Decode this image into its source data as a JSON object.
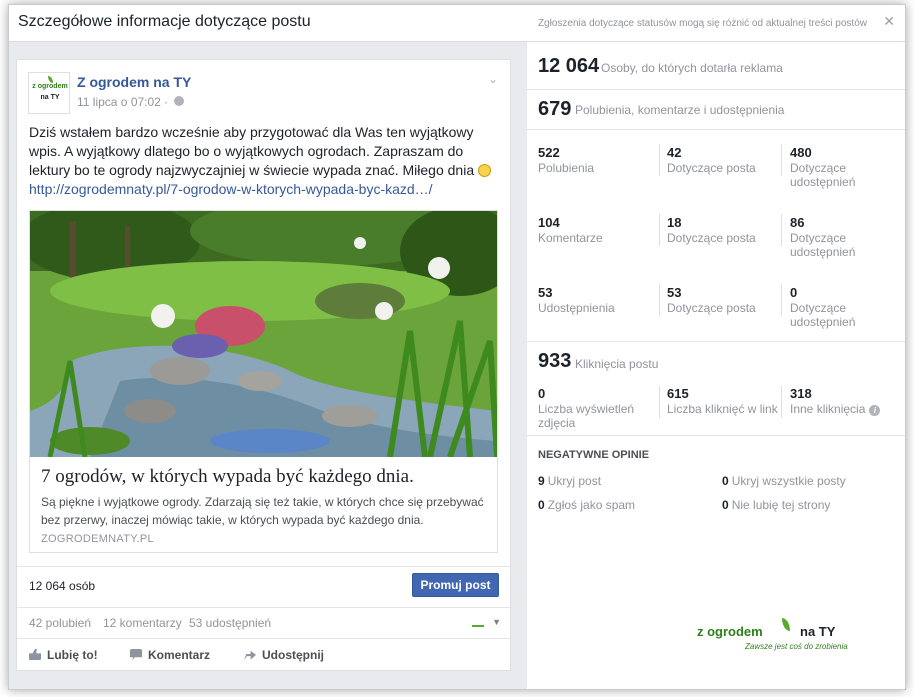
{
  "dialog": {
    "title": "Szczegółowe informacje dotyczące postu",
    "note": "Zgłoszenia dotyczące statusów mogą się różnić od aktualnej treści postów",
    "close_label": "✕"
  },
  "post": {
    "page_name": "Z ogrodem na TY",
    "logo_line1": "z ogrodem",
    "logo_line2": "na TY",
    "time": "11 lipca o 07:02 ·",
    "text": "Dziś wstałem bardzo wcześnie aby przygotować dla Was ten wyjątkowy wpis. A wyjątkowy dlatego bo o wyjątkowych ogrodach. Zapraszam do lektury bo te ogrody najzwyczajniej w świecie wypada znać. Miłego dnia",
    "link": "http://zogrodemnaty.pl/7-ogrodow-w-ktorych-wypada-byc-kazd…/",
    "attachment": {
      "title": "7 ogrodów, w których wypada być każdego dnia.",
      "description": "Są piękne i wyjątkowe ogrody. Zdarzają się też takie, w których chce się przebywać bez przerwy, inaczej mówiąc takie, w których wypada być każdego dnia.",
      "domain": "ZOGRODEMNATY.PL"
    },
    "reach": "12 064 osób",
    "promote_label": "Promuj post",
    "likes": "42 polubień",
    "comments": "12 komentarzy",
    "shares": "53 udostępnień",
    "actions": {
      "like": "Lubię to!",
      "comment": "Komentarz",
      "share": "Udostępnij"
    }
  },
  "stats": {
    "reach_num": "12 064",
    "reach_label": "Osoby, do których dotarła reklama",
    "engagement_num": "679",
    "engagement_label": "Polubienia, komentarze i udostępnienia",
    "rows": [
      [
        {
          "num": "522",
          "label": "Polubienia"
        },
        {
          "num": "42",
          "label": "Dotyczące posta"
        },
        {
          "num": "480",
          "label": "Dotyczące udostępnień"
        }
      ],
      [
        {
          "num": "104",
          "label": "Komentarze"
        },
        {
          "num": "18",
          "label": "Dotyczące posta"
        },
        {
          "num": "86",
          "label": "Dotyczące udostępnień"
        }
      ],
      [
        {
          "num": "53",
          "label": "Udostępnienia"
        },
        {
          "num": "53",
          "label": "Dotyczące posta"
        },
        {
          "num": "0",
          "label": "Dotyczące udostępnień"
        }
      ]
    ],
    "clicks_num": "933",
    "clicks_label": "Kliknięcia postu",
    "clicks": [
      {
        "num": "0",
        "label": "Liczba wyświetleń zdjęcia"
      },
      {
        "num": "615",
        "label": "Liczba kliknięć w link"
      },
      {
        "num": "318",
        "label": "Inne kliknięcia"
      }
    ],
    "negative_title": "NEGATYWNE OPINIE",
    "negative": [
      {
        "num": "9",
        "label": "Ukryj post"
      },
      {
        "num": "0",
        "label": "Ukryj wszystkie posty"
      },
      {
        "num": "0",
        "label": "Zgłoś jako spam"
      },
      {
        "num": "0",
        "label": "Nie lubię tej strony"
      }
    ]
  },
  "brand": {
    "name_part1": "z ogrodem",
    "name_part2": "na TY",
    "tagline": "Zawsze jest coś do zrobienia"
  },
  "colors": {
    "link": "#365899",
    "button": "#4267b2",
    "muted": "#90949c"
  }
}
